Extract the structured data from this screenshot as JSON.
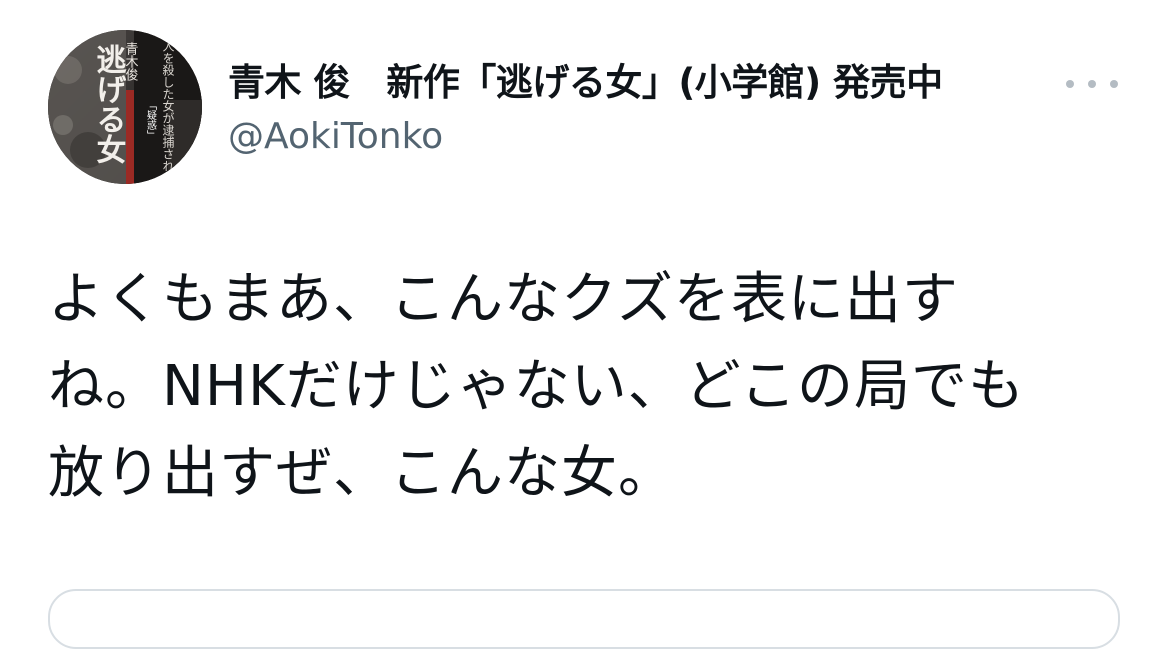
{
  "tweet": {
    "author": {
      "display_name": "青木 俊　新作「逃げる女」(小学館) 発売中",
      "handle": "@AokiTonko",
      "avatar": {
        "title_text": "逃げる女",
        "author_text": "青木俊",
        "label_text": "「疑惑」",
        "blurb_text": "人を殺した女が逮捕される"
      }
    },
    "text": "よくもまあ、こんなクズを表に出す\nね。NHKだけじゃない、どこの局でも\n放り出すぜ、こんな女。",
    "more_icon": "more-horizontal-icon"
  },
  "colors": {
    "text_primary": "#0f1419",
    "text_secondary": "#536471",
    "more_dots": "#b4bcc3",
    "card_border": "#d8dee3"
  }
}
